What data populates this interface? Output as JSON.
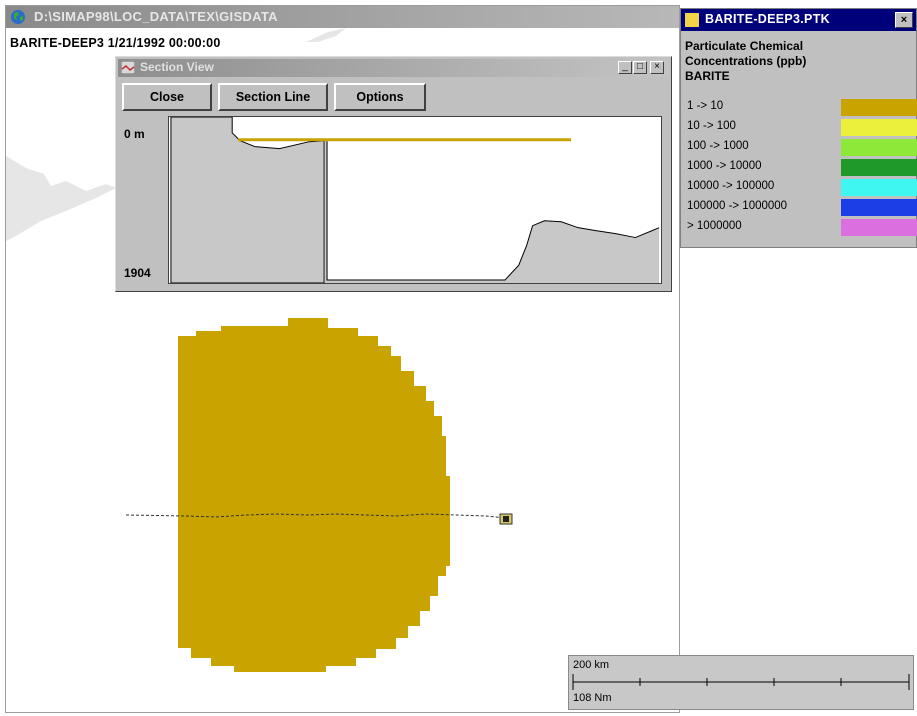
{
  "main_window": {
    "title": "D:\\SIMAP98\\LOC_DATA\\TEX\\GISDATA",
    "simulation_label": "BARITE-DEEP3 1/21/1992 00:00:00"
  },
  "map": {
    "plume_color": "#c9a400",
    "land_color": "#e6e6e6"
  },
  "section_view": {
    "title": "Section View",
    "buttons": {
      "close": "Close",
      "section_line": "Section Line",
      "options": "Options"
    },
    "depth_top": "0 m",
    "depth_bottom": "1904",
    "window_controls": {
      "minimize": "_",
      "maximize": "□",
      "close": "×"
    }
  },
  "legend": {
    "title": "BARITE-DEEP3.PTK",
    "close": "×",
    "heading_line1": "Particulate Chemical",
    "heading_line2": "Concentrations (ppb)",
    "chemical": "BARITE",
    "items": [
      {
        "label": "1 -> 10",
        "color": "#c9a400"
      },
      {
        "label": "10 -> 100",
        "color": "#eaf03c"
      },
      {
        "label": "100 -> 1000",
        "color": "#8ee83a"
      },
      {
        "label": "1000 -> 10000",
        "color": "#1f9a2a"
      },
      {
        "label": "10000 -> 100000",
        "color": "#3ff6f0"
      },
      {
        "label": "100000 -> 1000000",
        "color": "#1b3fe6"
      },
      {
        "label": "> 1000000",
        "color": "#dc6fe0"
      }
    ]
  },
  "scale_bar": {
    "km_label": "200 km",
    "nm_label": "108 Nm"
  }
}
